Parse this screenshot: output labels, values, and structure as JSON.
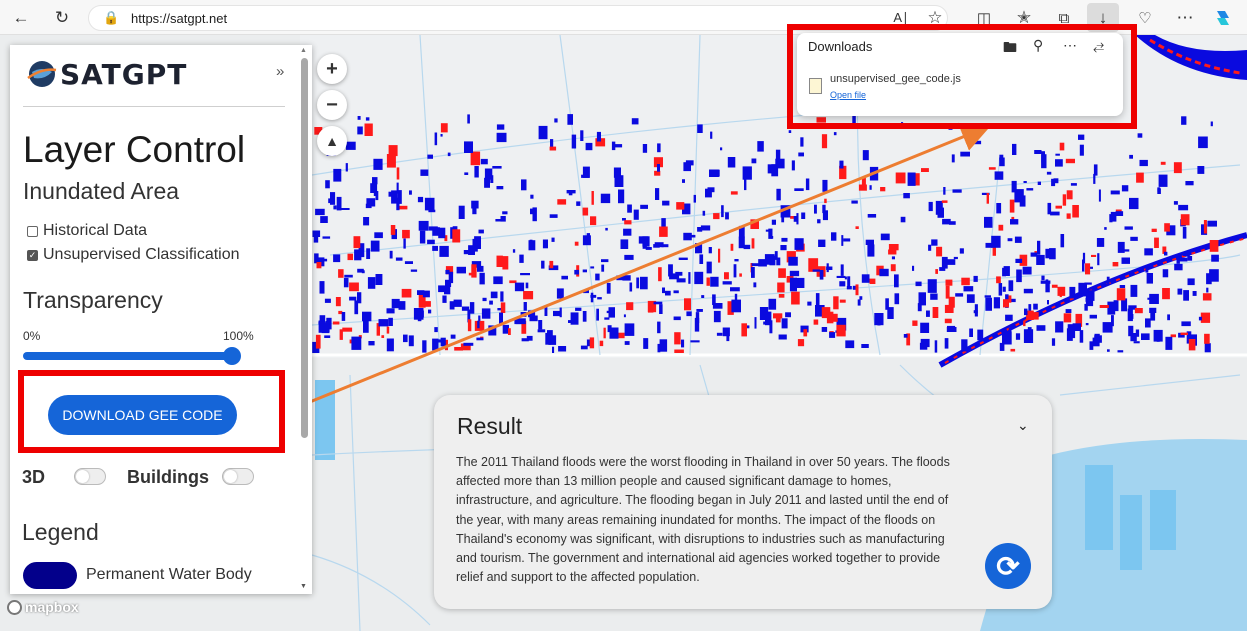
{
  "browser": {
    "url": "https://satgpt.net",
    "icons": [
      "back-icon",
      "refresh-icon",
      "lock-icon",
      "read-aloud-icon",
      "favorite-star-icon",
      "split-screen-icon",
      "favorites-icon",
      "collections-icon",
      "downloads-icon",
      "performance-icon",
      "more-icon",
      "copilot-icon"
    ]
  },
  "downloads": {
    "title": "Downloads",
    "file_name": "unsupervised_gee_code.js",
    "open_link": "Open file"
  },
  "panel": {
    "logo_text": "SATGPT",
    "collapse": "»",
    "title": "Layer Control",
    "subtitle": "Inundated Area",
    "checkboxes": [
      {
        "label": "Historical Data",
        "checked": false
      },
      {
        "label": "Unsupervised Classification",
        "checked": true
      }
    ],
    "transparency": {
      "heading": "Transparency",
      "min_label": "0%",
      "max_label": "100%",
      "value": 1.0
    },
    "download_button": "DOWNLOAD GEE CODE",
    "toggles": [
      {
        "label": "3D",
        "on": false
      },
      {
        "label": "Buildings",
        "on": false
      }
    ],
    "legend": {
      "heading": "Legend",
      "items": [
        {
          "label": "Permanent Water Body",
          "color": "#03008b"
        }
      ]
    }
  },
  "map": {
    "zoom_in": "+",
    "zoom_out": "−",
    "attribution": "mapbox",
    "flood_colors": {
      "blue": "#0a0adf",
      "red": "#ff1a1a"
    }
  },
  "result": {
    "title": "Result",
    "text": "The 2011 Thailand floods were the worst flooding in Thailand in over 50 years. The floods affected more than 13 million people and caused significant damage to homes, infrastructure, and agriculture. The flooding began in July 2011 and lasted until the end of the year, with many areas remaining inundated for months. The impact of the floods on Thailand's economy was significant, with disruptions to industries such as manufacturing and tourism. The government and international aid agencies worked together to provide relief and support to the affected population."
  },
  "annotations": {
    "highlight_color": "#ee0000",
    "arrow_color": "#ed7d31"
  }
}
